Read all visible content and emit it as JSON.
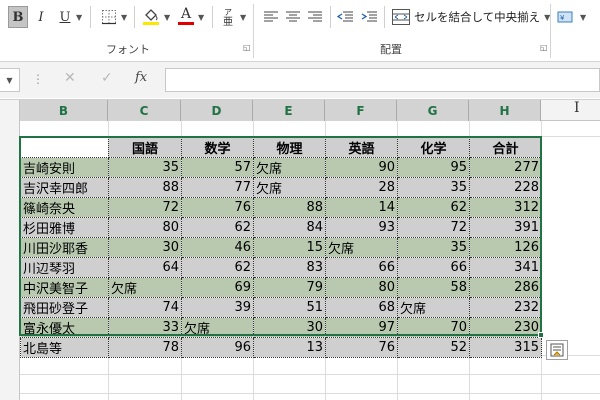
{
  "ribbon": {
    "bold_label": "B",
    "italic_label": "I",
    "underline_label": "U",
    "font_color_label": "A",
    "font_group_label": "フォント",
    "alignment_group_label": "配置",
    "merge_center_label": "セルを結合して中央揃え",
    "accent_color": "#217346",
    "font_color_bar": "#e00000",
    "fill_color_bar": "#ffe600"
  },
  "formula_bar": {
    "fx_label": "fx",
    "formula_value": ""
  },
  "columns": [
    "B",
    "C",
    "D",
    "E",
    "F",
    "G",
    "H"
  ],
  "partial_column": "I",
  "table": {
    "headers": [
      "",
      "国語",
      "数学",
      "物理",
      "英語",
      "化学",
      "合計"
    ],
    "rows": [
      [
        "吉崎安則",
        "35",
        "57",
        "欠席",
        "90",
        "95",
        "277"
      ],
      [
        "吉沢幸四郎",
        "88",
        "77",
        "欠席",
        "28",
        "35",
        "228"
      ],
      [
        "篠崎奈央",
        "72",
        "76",
        "88",
        "14",
        "62",
        "312"
      ],
      [
        "杉田雅博",
        "80",
        "62",
        "84",
        "93",
        "72",
        "391"
      ],
      [
        "川田沙耶香",
        "30",
        "46",
        "15",
        "欠席",
        "35",
        "126"
      ],
      [
        "川辺琴羽",
        "64",
        "62",
        "83",
        "66",
        "66",
        "341"
      ],
      [
        "中沢美智子",
        "欠席",
        "69",
        "79",
        "80",
        "58",
        "286"
      ],
      [
        "飛田砂登子",
        "74",
        "39",
        "51",
        "68",
        "欠席",
        "232"
      ],
      [
        "富永優太",
        "33",
        "欠席",
        "30",
        "97",
        "70",
        "230"
      ],
      [
        "北島等",
        "78",
        "96",
        "13",
        "76",
        "52",
        "315"
      ]
    ]
  },
  "colors": {
    "band_green": "#b8c9b0",
    "band_gray": "#cfcfcf",
    "selection_border": "#217346",
    "header_text": "#217346"
  }
}
